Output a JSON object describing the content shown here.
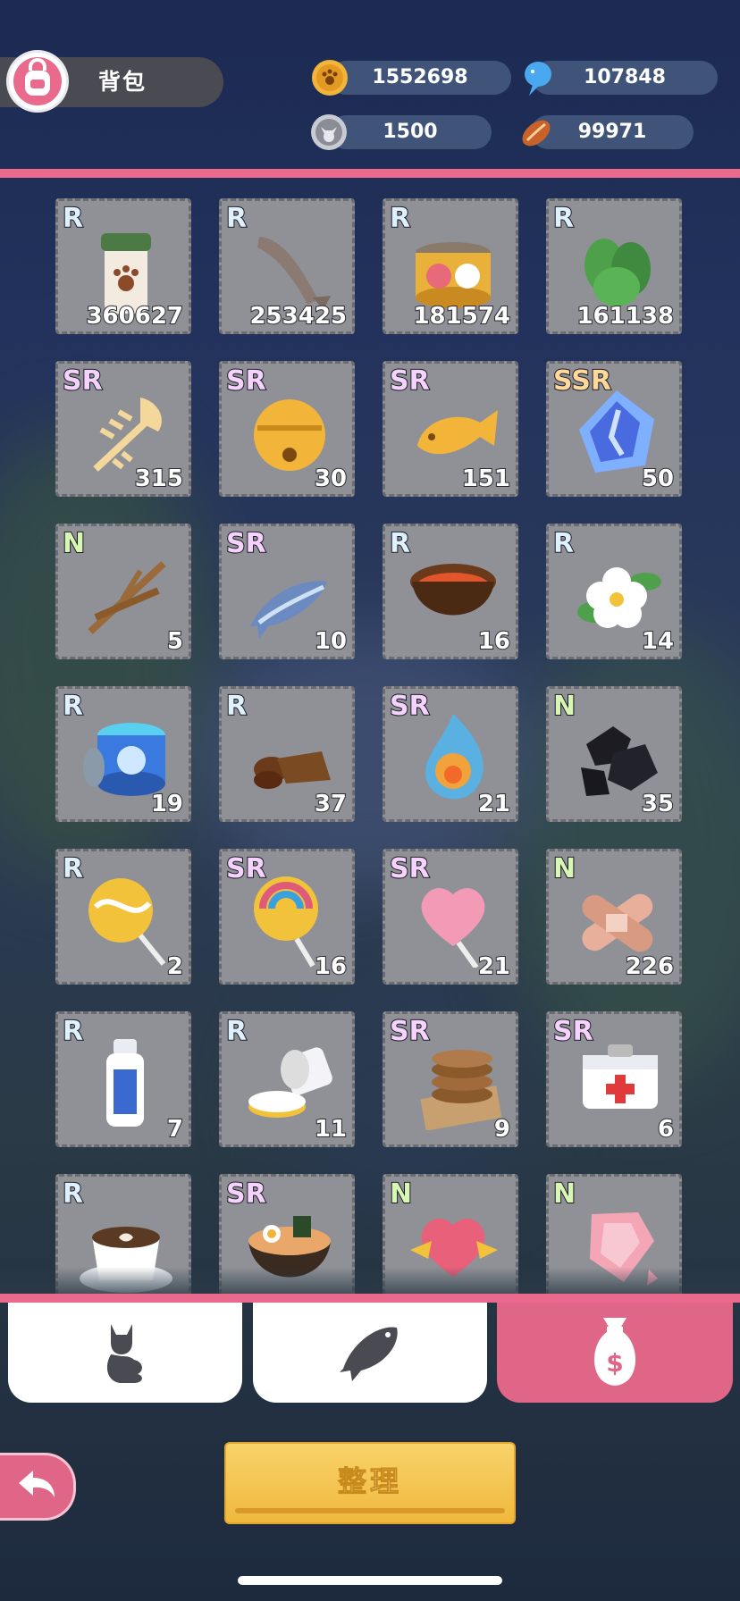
{
  "header": {
    "title": "背包",
    "currencies": [
      {
        "name": "paw-coin",
        "value": "1552698",
        "color": "#f2b53a"
      },
      {
        "name": "blue-fish",
        "value": "107848",
        "color": "#4aa8f0"
      },
      {
        "name": "silver-cat",
        "value": "1500",
        "color": "#c9cbd2"
      },
      {
        "name": "bean",
        "value": "99971",
        "color": "#c8622a"
      }
    ]
  },
  "items": [
    {
      "rarity": "R",
      "count": "360627",
      "icon": "paw-jar-icon"
    },
    {
      "rarity": "R",
      "count": "253425",
      "icon": "dried-fish-icon"
    },
    {
      "rarity": "R",
      "count": "181574",
      "icon": "cat-food-can-icon"
    },
    {
      "rarity": "R",
      "count": "161138",
      "icon": "mint-leaves-icon"
    },
    {
      "rarity": "SR",
      "count": "315",
      "icon": "fish-bone-icon"
    },
    {
      "rarity": "SR",
      "count": "30",
      "icon": "gold-bell-icon"
    },
    {
      "rarity": "SR",
      "count": "151",
      "icon": "taiyaki-icon"
    },
    {
      "rarity": "SSR",
      "count": "50",
      "icon": "blue-crystal-icon"
    },
    {
      "rarity": "N",
      "count": "5",
      "icon": "twigs-icon"
    },
    {
      "rarity": "SR",
      "count": "10",
      "icon": "blue-fish-icon"
    },
    {
      "rarity": "R",
      "count": "16",
      "icon": "sauce-bowl-icon"
    },
    {
      "rarity": "R",
      "count": "14",
      "icon": "white-flower-icon"
    },
    {
      "rarity": "R",
      "count": "19",
      "icon": "glue-jar-icon"
    },
    {
      "rarity": "R",
      "count": "37",
      "icon": "chocolate-icon"
    },
    {
      "rarity": "SR",
      "count": "21",
      "icon": "fire-orb-icon"
    },
    {
      "rarity": "N",
      "count": "35",
      "icon": "coal-icon"
    },
    {
      "rarity": "R",
      "count": "2",
      "icon": "yellow-lollipop-icon"
    },
    {
      "rarity": "SR",
      "count": "16",
      "icon": "rainbow-lollipop-icon"
    },
    {
      "rarity": "SR",
      "count": "21",
      "icon": "heart-lollipop-icon"
    },
    {
      "rarity": "N",
      "count": "226",
      "icon": "bandage-icon"
    },
    {
      "rarity": "R",
      "count": "7",
      "icon": "bottle-icon"
    },
    {
      "rarity": "R",
      "count": "11",
      "icon": "cream-jar-icon"
    },
    {
      "rarity": "SR",
      "count": "9",
      "icon": "cookie-stack-icon"
    },
    {
      "rarity": "SR",
      "count": "6",
      "icon": "first-aid-kit-icon"
    },
    {
      "rarity": "R",
      "count": "",
      "icon": "coffee-cup-icon"
    },
    {
      "rarity": "SR",
      "count": "",
      "icon": "ramen-bowl-icon"
    },
    {
      "rarity": "N",
      "count": "",
      "icon": "pink-heart-icon"
    },
    {
      "rarity": "N",
      "count": "",
      "icon": "pink-gem-icon"
    }
  ],
  "tabs": [
    {
      "name": "cat",
      "icon": "cat-icon",
      "active": false
    },
    {
      "name": "fish",
      "icon": "fish-icon",
      "active": false
    },
    {
      "name": "money-bag",
      "icon": "money-bag-icon",
      "active": true
    }
  ],
  "footer": {
    "sort_label": "整理"
  }
}
